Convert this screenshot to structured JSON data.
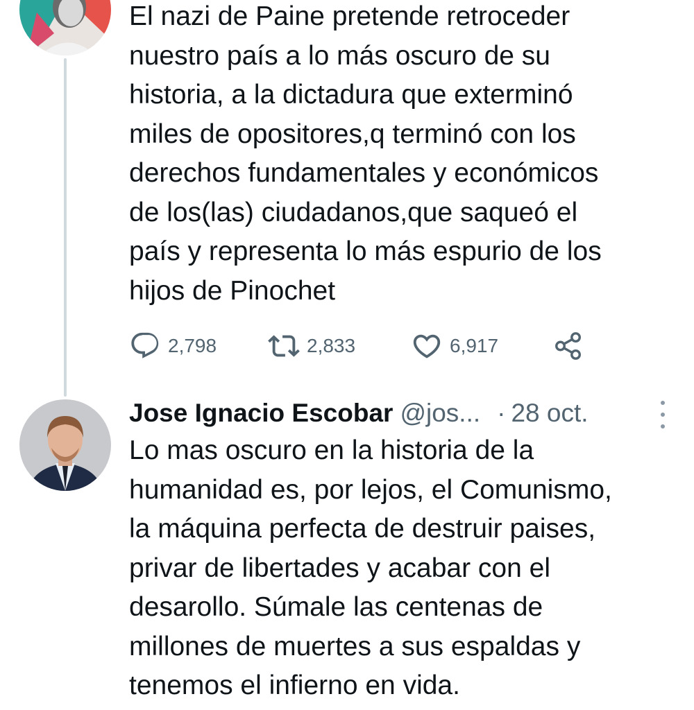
{
  "tweets": [
    {
      "text": "El nazi de Paine pretende retroceder\nnuestro país a lo más oscuro de su\nhistoria, a la dictadura que exterminó\nmiles de opositores,q terminó con los\nderechos fundamentales y económicos\nde los(las) ciudadanos,que saqueó el\npaís y representa lo más espurio de los\nhijos de Pinochet",
      "avatar_icon": "user-avatar-icon",
      "actions": {
        "reply_count": "2,798",
        "retweet_count": "2,833",
        "like_count": "6,917"
      },
      "action_icons": [
        "reply-icon",
        "retweet-icon",
        "like-icon",
        "share-icon"
      ]
    },
    {
      "author_name": "Jose Ignacio Escobar",
      "author_handle": "@jos...",
      "separator": "·",
      "date": "28 oct.",
      "text": "Lo mas oscuro en la historia de la\nhumanidad es, por lejos, el Comunismo,\nla máquina perfecta de destruir paises,\nprivar de libertades y acabar con el\ndesarollo. Súmale las centenas de\nmillones de muertes a sus espaldas y\ntenemos el infierno en vida.",
      "avatar_icon": "user-avatar-icon"
    }
  ],
  "colors": {
    "text": "#0f1419",
    "secondary": "#536471",
    "thread_line": "#cfd9de"
  }
}
